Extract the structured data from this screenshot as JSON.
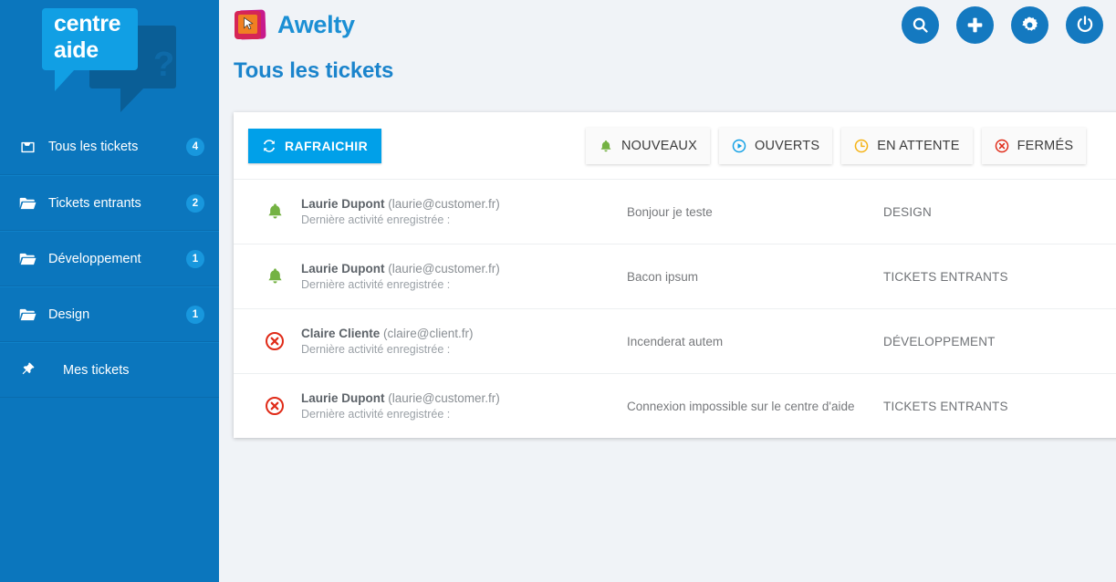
{
  "sidebar": {
    "logo": {
      "line1": "centre",
      "line2": "aide",
      "question_mark": "?"
    },
    "items": [
      {
        "label": "Tous les tickets",
        "badge": "4",
        "icon": "inbox-icon",
        "indented": false
      },
      {
        "label": "Tickets entrants",
        "badge": "2",
        "icon": "folder-open-icon",
        "indented": false
      },
      {
        "label": "Développement",
        "badge": "1",
        "icon": "folder-open-icon",
        "indented": false
      },
      {
        "label": "Design",
        "badge": "1",
        "icon": "folder-open-icon",
        "indented": false
      },
      {
        "label": "Mes tickets",
        "badge": "",
        "icon": "pin-icon",
        "indented": true
      }
    ]
  },
  "header": {
    "brand_name": "Awelty",
    "actions": [
      {
        "name": "search-button",
        "icon": "search-icon"
      },
      {
        "name": "add-button",
        "icon": "plus-icon"
      },
      {
        "name": "settings-button",
        "icon": "gear-icon"
      },
      {
        "name": "logout-button",
        "icon": "power-icon"
      }
    ]
  },
  "page": {
    "title": "Tous les tickets"
  },
  "toolbar": {
    "refresh_label": "RAFRAICHIR",
    "filters": [
      {
        "label": "NOUVEAUX",
        "icon": "bell-icon",
        "color": "#74b243"
      },
      {
        "label": "OUVERTS",
        "icon": "play-circle-icon",
        "color": "#12a0e5"
      },
      {
        "label": "EN ATTENTE",
        "icon": "clock-icon",
        "color": "#f5b316"
      },
      {
        "label": "FERMÉS",
        "icon": "x-circle-icon",
        "color": "#e02b18"
      }
    ]
  },
  "tickets": [
    {
      "status_icon": "bell-icon",
      "status_color": "#74b243",
      "name": "Laurie Dupont",
      "email": "(laurie@customer.fr)",
      "activity": "Dernière activité enregistrée :",
      "subject": "Bonjour je teste",
      "category": "DESIGN"
    },
    {
      "status_icon": "bell-icon",
      "status_color": "#74b243",
      "name": "Laurie Dupont",
      "email": "(laurie@customer.fr)",
      "activity": "Dernière activité enregistrée :",
      "subject": "Bacon ipsum",
      "category": "TICKETS ENTRANTS"
    },
    {
      "status_icon": "x-circle-icon",
      "status_color": "#e02b18",
      "name": "Claire Cliente",
      "email": "(claire@client.fr)",
      "activity": "Dernière activité enregistrée :",
      "subject": "Incenderat autem",
      "category": "DÉVELOPPEMENT"
    },
    {
      "status_icon": "x-circle-icon",
      "status_color": "#e02b18",
      "name": "Laurie Dupont",
      "email": "(laurie@customer.fr)",
      "activity": "Dernière activité enregistrée :",
      "subject": "Connexion impossible sur le centre d'aide",
      "category": "TICKETS ENTRANTS"
    }
  ],
  "colors": {
    "sidebar_bg": "#0b76bd",
    "brand_blue": "#1b8fd4",
    "page_bg": "#f0f3f7",
    "refresh_blue": "#00a0e9",
    "badge_blue": "#1897dd"
  }
}
